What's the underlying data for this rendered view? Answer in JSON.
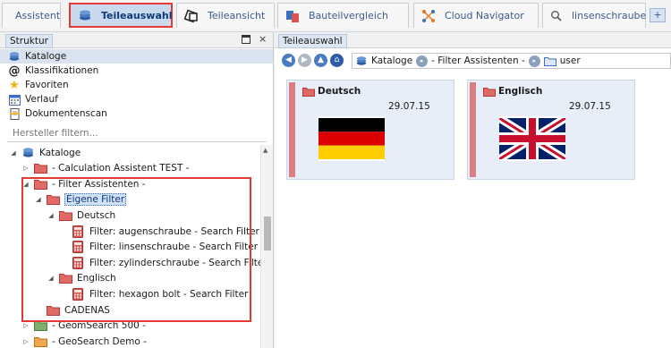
{
  "tabs": [
    {
      "label": "Assistent",
      "icon": "none",
      "active": false
    },
    {
      "label": "Teileauswahl",
      "icon": "catalog-stack-icon",
      "active": true
    },
    {
      "label": "Teileansicht",
      "icon": "parts-view-icon",
      "active": false
    },
    {
      "label": "Bauteilvergleich",
      "icon": "compare-icon",
      "active": false
    },
    {
      "label": "Cloud Navigator",
      "icon": "cloud-network-icon",
      "active": false
    },
    {
      "label": "linsenschraube",
      "icon": "search-icon",
      "active": false
    }
  ],
  "tab_add_label": "+",
  "left_panel": {
    "title": "Struktur",
    "close_glyph": "×",
    "nav_items": [
      {
        "label": "Kataloge",
        "icon": "catalog-stack-icon",
        "selected": true
      },
      {
        "label": "Klassifikationen",
        "icon": "at-sign-icon",
        "selected": false
      },
      {
        "label": "Favoriten",
        "icon": "star-icon",
        "selected": false
      },
      {
        "label": "Verlauf",
        "icon": "calendar-icon",
        "selected": false
      },
      {
        "label": "Dokumentenscan",
        "icon": "document-scan-icon",
        "selected": false
      }
    ],
    "filter_placeholder": "Hersteller filtern...",
    "tree": [
      {
        "label": "Kataloge",
        "depth": 0,
        "expanded": true,
        "icon": "catalog-stack-icon"
      },
      {
        "label": "- Calculation Assistent TEST -",
        "depth": 1,
        "expanded": false,
        "icon": "folder-red-icon"
      },
      {
        "label": "- Filter Assistenten -",
        "depth": 1,
        "expanded": true,
        "icon": "folder-red-icon"
      },
      {
        "label": "Eigene Filter",
        "depth": 2,
        "expanded": true,
        "icon": "folder-red-icon",
        "highlighted": true
      },
      {
        "label": "Deutsch",
        "depth": 3,
        "expanded": true,
        "icon": "folder-red-icon"
      },
      {
        "label": "Filter: augenschraube - Search Filter",
        "depth": 4,
        "icon": "calculator-icon"
      },
      {
        "label": "Filter: linsenschraube - Search Filter",
        "depth": 4,
        "icon": "calculator-icon"
      },
      {
        "label": "Filter: zylinderschraube - Search Filter",
        "depth": 4,
        "icon": "calculator-icon"
      },
      {
        "label": "Englisch",
        "depth": 3,
        "expanded": true,
        "icon": "folder-red-icon"
      },
      {
        "label": "Filter: hexagon bolt - Search Filter",
        "depth": 4,
        "icon": "calculator-icon"
      },
      {
        "label": "CADENAS",
        "depth": 2,
        "icon": "folder-red-icon"
      },
      {
        "label": "- GeomSearch 500 -",
        "depth": 1,
        "expanded": false,
        "icon": "folder-green-icon"
      },
      {
        "label": "- GeoSearch Demo -",
        "depth": 1,
        "expanded": false,
        "icon": "folder-orange-icon"
      }
    ]
  },
  "right_panel": {
    "title": "Teileauswahl",
    "breadcrumb": [
      "Kataloge",
      "- Filter Assistenten -",
      "user"
    ],
    "cards": [
      {
        "title": "Deutsch",
        "date": "29.07.15",
        "flag": "germany-flag"
      },
      {
        "title": "Englisch",
        "date": "29.07.15",
        "flag": "uk-flag"
      }
    ]
  },
  "colors": {
    "accent_red": "#e53935",
    "tab_active_bg": "#c9daef",
    "folder_red": "#d9534f",
    "card_bg": "#e7eef7"
  }
}
